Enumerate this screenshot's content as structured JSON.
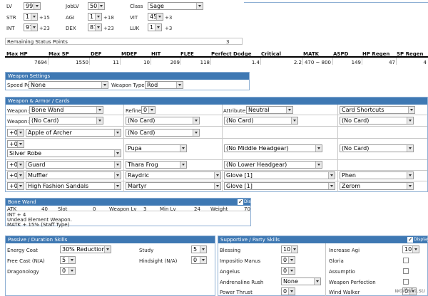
{
  "base": {
    "lv_label": "LV",
    "lv": "99",
    "joblv_label": "JobLV",
    "joblv": "50",
    "class_label": "Class",
    "class": "Sage",
    "stats": [
      {
        "label": "STR",
        "value": "1",
        "bonus": "+15"
      },
      {
        "label": "AGI",
        "value": "1",
        "bonus": "+18"
      },
      {
        "label": "VIT",
        "value": "45",
        "bonus": "+3"
      },
      {
        "label": "INT",
        "value": "97",
        "bonus": "+23"
      },
      {
        "label": "DEX",
        "value": "87",
        "bonus": "+23"
      },
      {
        "label": "LUK",
        "value": "1",
        "bonus": "+3"
      }
    ],
    "remaining_label": "Remaining Status Points",
    "remaining_value": "3"
  },
  "summary": {
    "headers": [
      "Max HP",
      "Max SP",
      "DEF",
      "MDEF",
      "HIT",
      "FLEE",
      "Perfect Dodge",
      "Critical",
      "MATK",
      "ASPD",
      "HP Regen",
      "SP Regen"
    ],
    "values": [
      "7694",
      "1550",
      "11",
      "10",
      "209",
      "118",
      "1.4",
      "2.2",
      "470 ~ 800",
      "149",
      "47",
      "4"
    ]
  },
  "weapon_settings": {
    "title": "Weapon Settings",
    "speed_potion_label": "Speed Potion:",
    "speed_potion": "None",
    "weapon_type_label": "Weapon Type:",
    "weapon_type": "Rod"
  },
  "equip": {
    "title": "Weapon & Armor / Cards",
    "weapon_label": "Weapon:",
    "weapon": "Bone Wand",
    "refine_label": "Refine:",
    "refine": "0",
    "attribute_label": "Attribute:",
    "attribute": "Neutral",
    "card_shortcuts": "Card Shortcuts",
    "weapon2_label": "Weapon:",
    "weapon_cards": [
      "(No Card)",
      "(No Card)",
      "(No Card)",
      "(No Card)"
    ],
    "rows": [
      {
        "refine": "+0",
        "item": "Apple of Archer",
        "card": "(No Card)"
      },
      {
        "refine": "+0",
        "item": "Silver Robe",
        "card": "Pupa",
        "mid": "(No Middle Headgear)",
        "mid_card": "(No Card)"
      },
      {
        "refine": "+0",
        "item": "Guard",
        "card": "Thara Frog",
        "low": "(No Lower Headgear)"
      },
      {
        "refine": "+0",
        "item": "Muffler",
        "card": "Raydric",
        "acc": "Glove [1]",
        "acc_card": "Phen"
      },
      {
        "refine": "+0",
        "item": "High Fashion Sandals",
        "card": "Martyr",
        "acc": "Glove [1]",
        "acc_card": "Zerom"
      }
    ]
  },
  "weapon_info": {
    "title": "Bone Wand",
    "display": "Display",
    "cols": [
      "ATK",
      "40",
      "Slot",
      "0",
      "Weapon Lv",
      "3",
      "Min Lv",
      "24",
      "Weight",
      "70"
    ],
    "lines": [
      "INT + 4",
      "Undead Element Weapon.",
      "MATK + 15% (Staff Type)"
    ]
  },
  "passive": {
    "title": "Passive / Duration Skills",
    "skills": [
      {
        "label": "Energy Coat",
        "value": "30% Reduction"
      },
      {
        "label": "Study",
        "value": "5"
      },
      {
        "label": "Free Cast (N/A)",
        "value": "5"
      },
      {
        "label": "Hindsight (N/A)",
        "value": "0"
      },
      {
        "label": "Dragonology",
        "value": "0"
      }
    ]
  },
  "support": {
    "title": "Supportive / Party Skills",
    "display": "Display",
    "skills": [
      {
        "label": "Blessing",
        "value": "10"
      },
      {
        "label": "Increase Agi",
        "value": "10"
      },
      {
        "label": "Impositio Manus",
        "value": "0"
      },
      {
        "label": "Gloria"
      },
      {
        "label": "Angelus",
        "value": "0"
      },
      {
        "label": "Assumptio"
      },
      {
        "label": "Andrenaline Rush",
        "value": "None"
      },
      {
        "label": "Weapon Perfection"
      },
      {
        "label": "Power Thrust",
        "value": "0"
      },
      {
        "label": "Wind Walker",
        "value": "0"
      }
    ]
  },
  "watermark": "wolfalin.su"
}
